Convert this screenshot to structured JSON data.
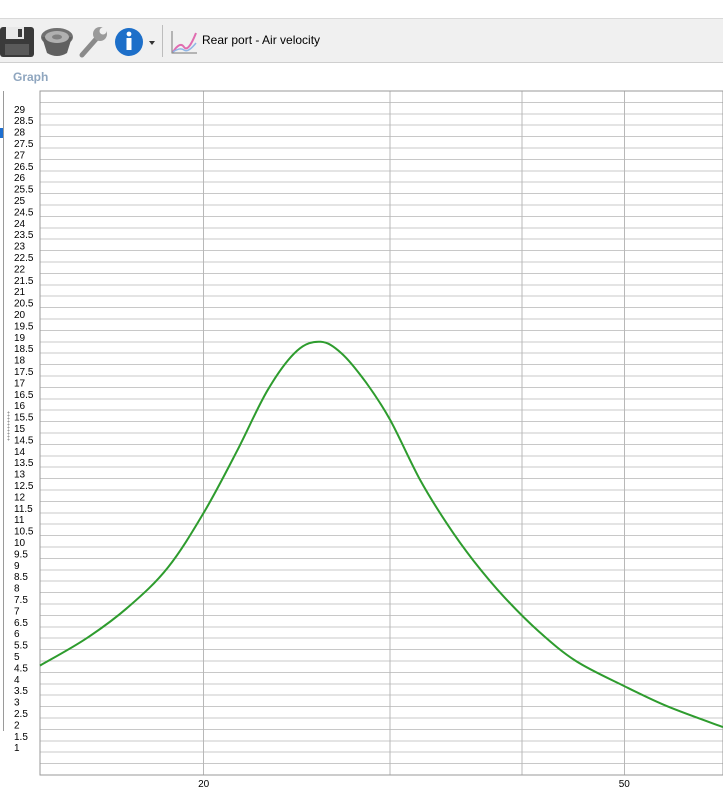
{
  "toolbar": {
    "buttons": [
      {
        "name": "save-icon"
      },
      {
        "name": "driver-icon"
      },
      {
        "name": "wrench-icon"
      },
      {
        "name": "info-icon"
      },
      {
        "name": "dropdown-arrow-icon"
      }
    ],
    "chart_icon": "line-chart-icon",
    "title": "Rear port - Air velocity"
  },
  "panel": {
    "label": "Graph"
  },
  "colors": {
    "curve": "#2e9c2e",
    "grid": "#c8c8c8",
    "panel_label": "#8fa6bf"
  },
  "chart_data": {
    "type": "line",
    "title": "Rear port - Air velocity",
    "xlabel": "",
    "ylabel": "",
    "x_scale": "log",
    "xlim": [
      14,
      62
    ],
    "ylim": [
      0,
      30
    ],
    "x_tick_labels": [
      "20",
      "50"
    ],
    "y_tick_labels": [
      "1",
      "1.5",
      "2",
      "2.5",
      "3",
      "3.5",
      "4",
      "4.5",
      "5",
      "5.5",
      "6",
      "6.5",
      "7",
      "7.5",
      "8",
      "8.5",
      "9",
      "9.5",
      "10",
      "10.5",
      "11",
      "11.5",
      "12",
      "12.5",
      "13",
      "13.5",
      "14",
      "14.5",
      "15",
      "15.5",
      "16",
      "16.5",
      "17",
      "17.5",
      "18",
      "18.5",
      "19",
      "19.5",
      "20",
      "20.5",
      "21",
      "21.5",
      "22",
      "22.5",
      "23",
      "23.5",
      "24",
      "24.5",
      "25",
      "25.5",
      "26",
      "26.5",
      "27",
      "27.5",
      "28",
      "28.5",
      "29"
    ],
    "grid": true,
    "series": [
      {
        "x": [
          14.0,
          15.5,
          17.0,
          18.5,
          20.0,
          21.5,
          23.0,
          24.5,
          25.8,
          27.0,
          28.5,
          30.0,
          32.0,
          34.0,
          36.0,
          38.5,
          41.5,
          45.0,
          50.0,
          55.0,
          62.0
        ],
        "y": [
          4.8,
          6.0,
          7.4,
          9.1,
          11.5,
          14.2,
          16.9,
          18.6,
          19.0,
          18.5,
          17.2,
          15.6,
          13.0,
          11.0,
          9.4,
          7.8,
          6.3,
          5.0,
          3.9,
          3.0,
          2.1
        ]
      }
    ]
  }
}
